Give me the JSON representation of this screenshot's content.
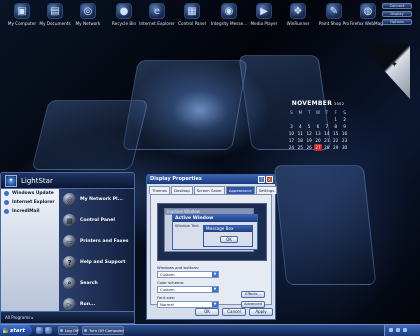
{
  "desktop_icons": [
    {
      "label": "My Computer",
      "icon": "computer-icon",
      "glyph": "▣"
    },
    {
      "label": "My Documents",
      "icon": "documents-icon",
      "glyph": "▤"
    },
    {
      "label": "My Network",
      "icon": "network-icon",
      "glyph": "◎"
    },
    {
      "label": "Recycle Bin",
      "icon": "recycle-bin-icon",
      "glyph": "●"
    },
    {
      "label": "Internet Explorer",
      "icon": "internet-explorer-icon",
      "glyph": "e"
    },
    {
      "label": "Control Panel",
      "icon": "control-panel-icon",
      "glyph": "▦"
    },
    {
      "label": "Integrity Messe...",
      "icon": "messenger-icon",
      "glyph": "◉"
    },
    {
      "label": "Media Player",
      "icon": "media-player-icon",
      "glyph": "▶"
    },
    {
      "label": "WinRunner",
      "icon": "windows-icon",
      "glyph": "❖"
    },
    {
      "label": "Paint Shop Pro",
      "icon": "paint-icon",
      "glyph": "✎"
    },
    {
      "label": "Firefox WebMagic",
      "icon": "web-icon",
      "glyph": "◍"
    },
    {
      "label": "Font Viewer",
      "icon": "font-icon",
      "glyph": "A"
    }
  ],
  "mini_buttons": [
    "Connect",
    "Display",
    "Options"
  ],
  "calendar": {
    "month": "NOVEMBER",
    "year": "2002",
    "day_headers": [
      "S",
      "M",
      "T",
      "W",
      "T",
      "F",
      "S"
    ],
    "weeks": [
      [
        "",
        "",
        "",
        "",
        "",
        "1",
        "2"
      ],
      [
        "3",
        "4",
        "5",
        "6",
        "7",
        "8",
        "9"
      ],
      [
        "10",
        "11",
        "12",
        "13",
        "14",
        "15",
        "16"
      ],
      [
        "17",
        "18",
        "19",
        "20",
        "21",
        "22",
        "23"
      ],
      [
        "24",
        "25",
        "26",
        "27",
        "28",
        "29",
        "30"
      ]
    ],
    "today": "27"
  },
  "start_menu": {
    "user": "LightStar",
    "left_items": [
      "Windows Update",
      "Internet Explorer",
      "IncrediMail"
    ],
    "right_items": [
      {
        "label": "My Network Pl...",
        "icon": "network-places-icon",
        "glyph": "◎"
      },
      {
        "label": "Control Panel",
        "icon": "control-panel-icon",
        "glyph": "▦"
      },
      {
        "label": "Printers and Faxes",
        "icon": "printer-icon",
        "glyph": "▭"
      },
      {
        "label": "Help and Support",
        "icon": "help-icon",
        "glyph": "?"
      },
      {
        "label": "Search",
        "icon": "search-icon",
        "glyph": "⌕"
      },
      {
        "label": "Run...",
        "icon": "run-icon",
        "glyph": "▷"
      }
    ],
    "all_programs": "All Programs"
  },
  "dialog": {
    "title": "Display Properties",
    "tabs": [
      "Themes",
      "Desktop",
      "Screen Saver",
      "Appearance",
      "Settings"
    ],
    "active_tab": 3,
    "preview": {
      "inactive_title": "Inactive Window",
      "active_title": "Active Window",
      "window_text": "Window Text",
      "message_title": "Message Box",
      "ok": "OK"
    },
    "windows_buttons_label": "Windows and buttons:",
    "windows_buttons_value": "Custom",
    "color_scheme_label": "Color scheme:",
    "color_scheme_value": "Custom",
    "font_size_label": "Font size:",
    "font_size_value": "Normal",
    "effects": "Effects...",
    "advanced": "Advanced",
    "ok": "OK",
    "cancel": "Cancel",
    "apply": "Apply"
  },
  "taskbar": {
    "start": "start",
    "tasks": [
      "Log Off",
      "Turn Off Computer"
    ]
  }
}
